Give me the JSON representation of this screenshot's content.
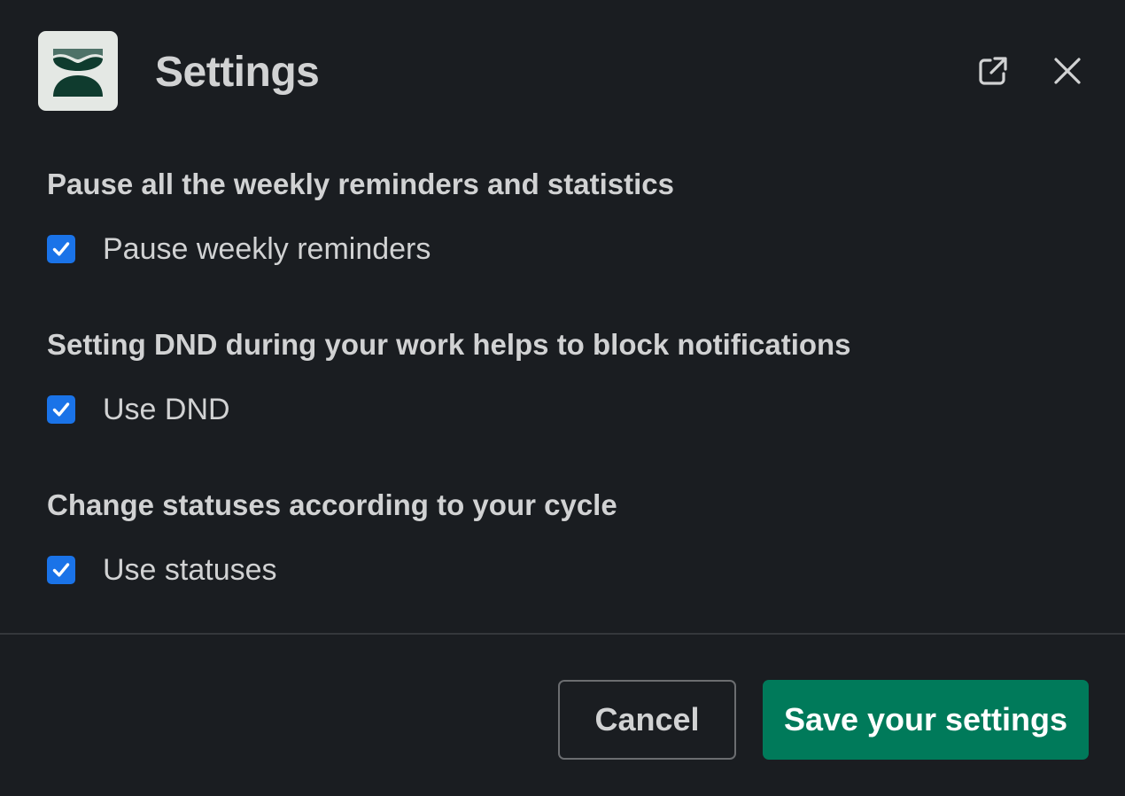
{
  "dialog": {
    "title": "Settings"
  },
  "sections": [
    {
      "heading": "Pause all the weekly reminders and statistics",
      "option_label": "Pause weekly reminders",
      "checked": true
    },
    {
      "heading": "Setting DND during your work helps to block notifications",
      "option_label": "Use DND",
      "checked": true
    },
    {
      "heading": "Change statuses according to your cycle",
      "option_label": "Use statuses",
      "checked": true
    }
  ],
  "footer": {
    "cancel_label": "Cancel",
    "save_label": "Save your settings"
  },
  "icons": {
    "logo": "hourglass-logo-icon",
    "open": "open-in-new-window-icon",
    "close": "close-icon",
    "check": "checkmark-icon"
  },
  "colors": {
    "background": "#1a1d21",
    "text": "#d1d2d3",
    "checkbox": "#1a73e8",
    "primary_button": "#007a5a",
    "logo_background": "#e4e8e4",
    "logo_foreground": "#0f3b2e"
  }
}
